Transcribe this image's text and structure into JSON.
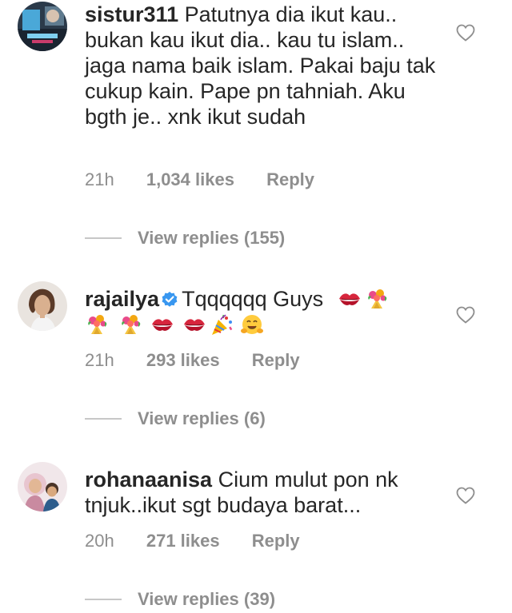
{
  "comments": [
    {
      "username": "sistur311",
      "text": "Patutnya dia ikut kau.. bukan kau ikut dia.. kau tu islam.. jaga nama baik islam. Pakai baju tak cukup kain. Pape pn tahniah. Aku bgth je.. xnk ikut sudah",
      "time": "21h",
      "likes": "1,034 likes",
      "reply": "Reply",
      "view_replies": "View replies (155)",
      "verified": false
    },
    {
      "username": "rajailya",
      "text": "Tqqqqqq Guys",
      "time": "21h",
      "likes": "293 likes",
      "reply": "Reply",
      "view_replies": "View replies (6)",
      "verified": true,
      "emojis": [
        "kiss-mark-icon",
        "bouquet-icon",
        "bouquet-icon",
        "bouquet-icon",
        "kiss-mark-icon",
        "kiss-mark-icon",
        "party-popper-icon",
        "hugging-face-icon"
      ]
    },
    {
      "username": "rohanaanisa",
      "text": "Cium mulut pon nk tnjuk..ikut sgt budaya barat...",
      "time": "20h",
      "likes": "271 likes",
      "reply": "Reply",
      "view_replies": "View replies (39)",
      "verified": false
    }
  ],
  "colors": {
    "text": "#262626",
    "secondary": "#8e8e8e",
    "verified_blue": "#3897f0",
    "divider": "#c7c7c7"
  }
}
